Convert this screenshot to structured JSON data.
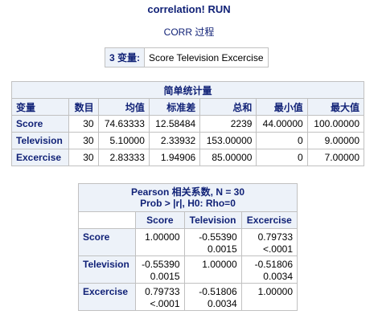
{
  "page": {
    "title": "correlation! RUN",
    "procedure": "CORR 过程"
  },
  "variables_box": {
    "label": "3 变量:",
    "value": "Score Television Excercise"
  },
  "simple_stats": {
    "caption": "简单统计量",
    "columns": [
      "变量",
      "数目",
      "均值",
      "标准差",
      "总和",
      "最小值",
      "最大值"
    ],
    "rows": [
      [
        "Score",
        "30",
        "74.63333",
        "12.58484",
        "2239",
        "44.00000",
        "100.00000"
      ],
      [
        "Television",
        "30",
        "5.10000",
        "2.33932",
        "153.00000",
        "0",
        "9.00000"
      ],
      [
        "Excercise",
        "30",
        "2.83333",
        "1.94906",
        "85.00000",
        "0",
        "7.00000"
      ]
    ]
  },
  "pearson": {
    "caption_line1": "Pearson 相关系数, N = 30",
    "caption_line2": "Prob > |r|, H0: Rho=0",
    "columns": [
      "Score",
      "Television",
      "Excercise"
    ],
    "rows": [
      {
        "name": "Score",
        "cells": [
          [
            "1.00000",
            ""
          ],
          [
            "-0.55390",
            "0.0015"
          ],
          [
            "0.79733",
            "<.0001"
          ]
        ]
      },
      {
        "name": "Television",
        "cells": [
          [
            "-0.55390",
            "0.0015"
          ],
          [
            "1.00000",
            ""
          ],
          [
            "-0.51806",
            "0.0034"
          ]
        ]
      },
      {
        "name": "Excercise",
        "cells": [
          [
            "0.79733",
            "<.0001"
          ],
          [
            "-0.51806",
            "0.0034"
          ],
          [
            "1.00000",
            ""
          ]
        ]
      }
    ]
  }
}
